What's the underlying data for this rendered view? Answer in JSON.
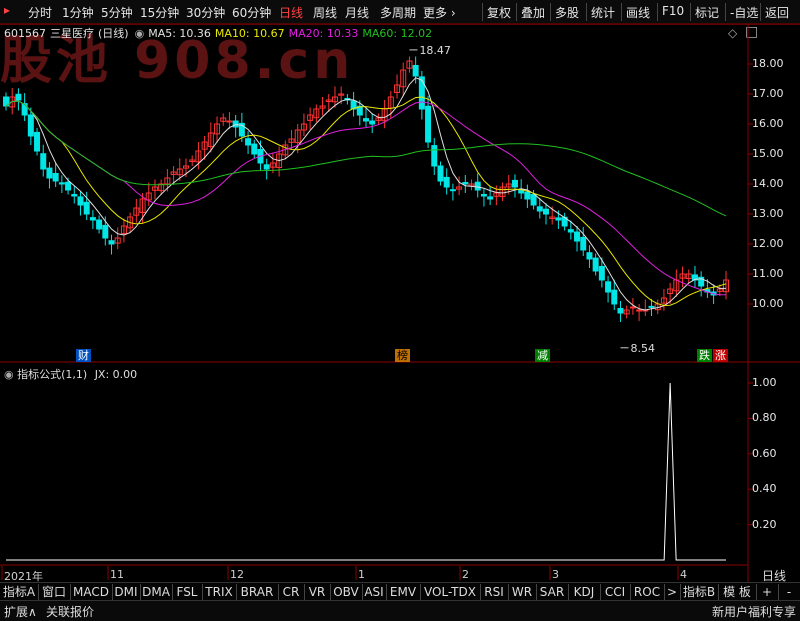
{
  "toolbar": {
    "periods": [
      "分时",
      "1分钟",
      "5分钟",
      "15分钟",
      "30分钟",
      "60分钟",
      "日线",
      "周线",
      "月线",
      "多周期"
    ],
    "more_label": "更多",
    "actions": [
      "复权",
      "叠加",
      "多股",
      "统计",
      "画线",
      "F10",
      "标记",
      "-自选",
      "返回"
    ],
    "active_period": "日线"
  },
  "watermark": "股池  908.cn",
  "stock": {
    "code": "601567",
    "name": "三星医疗",
    "period_suffix": "(日线)",
    "ma5_label": "MA5: 10.36",
    "ma10_label": "MA10: 10.67",
    "ma20_label": "MA20: 10.33",
    "ma60_label": "MA60: 12.02"
  },
  "colors": {
    "up": "#ff3333",
    "down": "#00e5e5",
    "ma5": "#e0e0e0",
    "ma10": "#e8e800",
    "ma20": "#e020e0",
    "ma60": "#20c020",
    "frame": "#8a0000"
  },
  "price_axis": [
    "18.00",
    "17.00",
    "16.00",
    "15.00",
    "14.00",
    "13.00",
    "12.00",
    "11.00",
    "10.00"
  ],
  "price_marks": {
    "high": "18.47",
    "low": "8.54"
  },
  "flags": [
    {
      "text": "财",
      "color": "#ffffff",
      "bg": "#0050c0"
    },
    {
      "text": "榜",
      "color": "#000000",
      "bg": "#c07000"
    },
    {
      "text": "减",
      "color": "#ffffff",
      "bg": "#008000"
    },
    {
      "text": "跌",
      "color": "#ffffff",
      "bg": "#008000"
    },
    {
      "text": "涨",
      "color": "#ffffff",
      "bg": "#c00000"
    }
  ],
  "indicator": {
    "title": "指标公式(1,1)",
    "value_label": "JX: 0.00",
    "axis": [
      "1.00",
      "0.80",
      "0.60",
      "0.40",
      "0.20"
    ]
  },
  "dates": [
    "2021年",
    "11",
    "12",
    "1",
    "2",
    "3",
    "4"
  ],
  "period_label": "日线",
  "tabs": [
    "指标A",
    "窗口",
    "MACD",
    "DMI",
    "DMA",
    "FSL",
    "TRIX",
    "BRAR",
    "CR",
    "VR",
    "OBV",
    "ASI",
    "EMV",
    "VOL-TDX",
    "RSI",
    "WR",
    "SAR",
    "KDJ",
    "CCI",
    "ROC",
    ">",
    "指标B",
    "模 板",
    "+",
    "-"
  ],
  "status": {
    "expand": "扩展∧",
    "quote": "关联报价",
    "promo": "新用户福利专享"
  },
  "chart_data": {
    "type": "candlestick",
    "title": "601567 三星医疗(日线)",
    "ylim": [
      8.3,
      18.8
    ],
    "high": 18.47,
    "low": 8.54,
    "close_series": [
      16.6,
      16.9,
      16.8,
      16.3,
      15.6,
      15.1,
      14.5,
      14.2,
      14.1,
      14.0,
      13.8,
      13.6,
      13.3,
      13.0,
      12.8,
      12.5,
      12.2,
      12.0,
      12.2,
      12.6,
      12.9,
      13.2,
      13.5,
      13.7,
      13.9,
      14.0,
      14.2,
      14.4,
      14.5,
      14.6,
      14.8,
      15.1,
      15.4,
      15.7,
      16.0,
      16.2,
      16.1,
      15.9,
      15.6,
      15.3,
      15.0,
      14.7,
      14.5,
      14.7,
      15.0,
      15.3,
      15.5,
      15.8,
      16.0,
      16.3,
      16.5,
      16.6,
      16.8,
      16.9,
      17.0,
      16.8,
      16.5,
      16.3,
      16.1,
      16.0,
      16.2,
      16.5,
      16.9,
      17.3,
      17.8,
      18.1,
      17.6,
      16.5,
      15.4,
      14.6,
      14.1,
      13.9,
      13.8,
      13.9,
      14.0,
      14.0,
      13.8,
      13.6,
      13.5,
      13.7,
      13.9,
      14.0,
      13.9,
      13.7,
      13.5,
      13.3,
      13.1,
      13.0,
      12.9,
      12.8,
      12.6,
      12.4,
      12.1,
      11.8,
      11.5,
      11.1,
      10.8,
      10.4,
      10.0,
      9.7,
      9.8,
      9.9,
      9.8,
      9.8,
      9.9,
      10.0,
      10.2,
      10.5,
      10.8,
      11.0,
      11.0,
      10.8,
      10.6,
      10.4,
      10.3,
      10.5,
      10.8
    ],
    "ma5": "10.36",
    "ma10": "10.67",
    "ma20": "10.33",
    "ma60": "12.02"
  }
}
